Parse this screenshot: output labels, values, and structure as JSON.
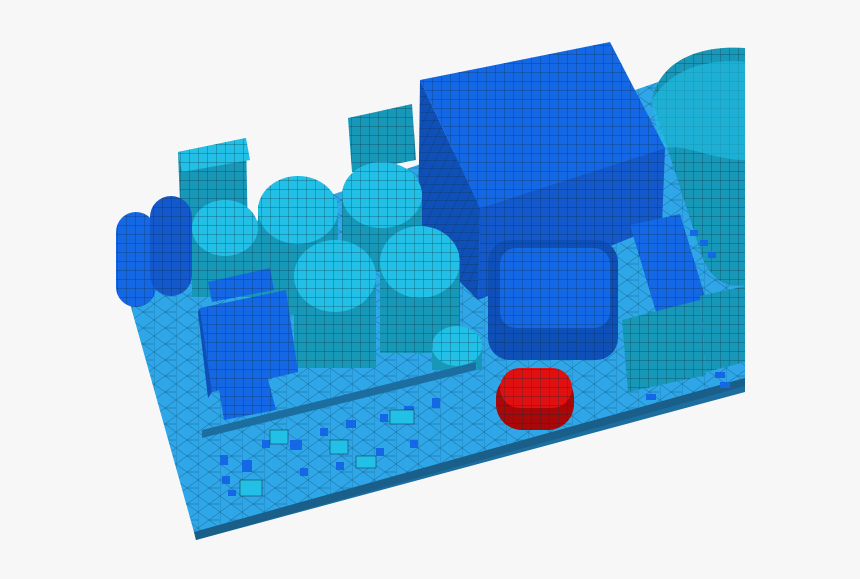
{
  "scene": {
    "subject": "",
    "colors": {
      "background": "#f7f7f7",
      "board_top": "#2ea6e8",
      "board_side": "#1d6ea0",
      "component_blue": "#1468e6",
      "component_blue_dark": "#0f4fb8",
      "component_cyan": "#22c0e6",
      "component_cyan_dark": "#1898b8",
      "highlight_red": "#e01010",
      "highlight_red_dark": "#a80808",
      "mesh_line": "#0a2a3a"
    }
  }
}
